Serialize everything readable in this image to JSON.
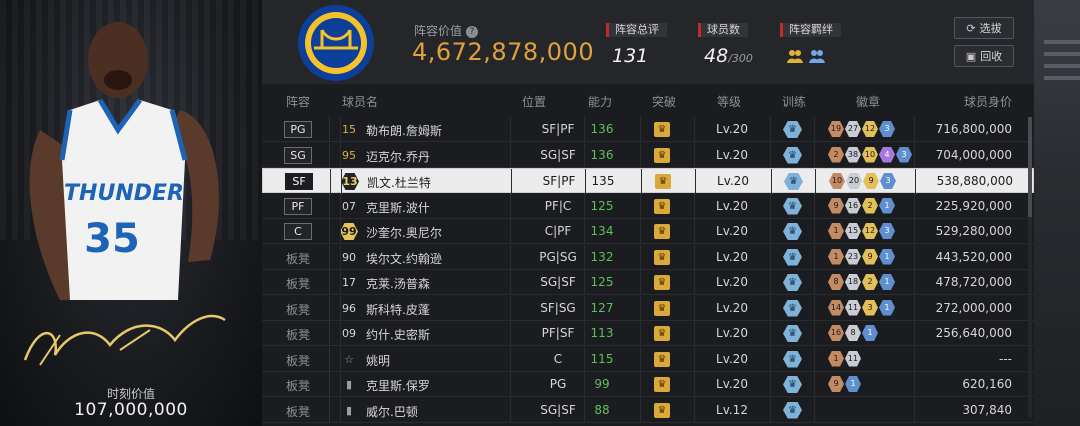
{
  "card": {
    "value_label": "时刻价值",
    "value": "107,000,000",
    "jersey_team": "THUNDER",
    "jersey_number": "35"
  },
  "header": {
    "lineup_label": "阵容价值",
    "lineup_value": "4,672,878,000",
    "rating_label": "阵容总评",
    "rating_value": "131",
    "players_label": "球员数",
    "players_value": "48",
    "players_max": "/300",
    "bond_label": "阵容羁绊",
    "select_button": "选拔",
    "recycle_button": "回收"
  },
  "columns": [
    "阵容",
    "球员名",
    "位置",
    "能力",
    "突破",
    "等级",
    "训练",
    "徽章",
    "球员身价"
  ],
  "rows": [
    {
      "slot": "PG",
      "num": "15",
      "num_style": "gold",
      "name": "勒布朗.詹姆斯",
      "pos": "SF|PF",
      "ability": "136",
      "level": "Lv.20",
      "badges": [
        [
          "bronze",
          "19"
        ],
        [
          "silver",
          "27"
        ],
        [
          "gold",
          "12"
        ],
        [
          "blue",
          "3"
        ]
      ],
      "value": "716,800,000"
    },
    {
      "slot": "SG",
      "num": "95",
      "num_style": "gold",
      "name": "迈克尔.乔丹",
      "pos": "SG|SF",
      "ability": "136",
      "level": "Lv.20",
      "badges": [
        [
          "bronze",
          "2"
        ],
        [
          "silver",
          "38"
        ],
        [
          "gold",
          "10"
        ],
        [
          "purple",
          "4"
        ],
        [
          "blue",
          "3"
        ]
      ],
      "value": "704,000,000"
    },
    {
      "slot": "SF",
      "num": "13",
      "num_style": "hexdark",
      "name": "凯文.杜兰特",
      "pos": "SF|PF",
      "ability": "135",
      "level": "Lv.20",
      "badges": [
        [
          "bronze",
          "10"
        ],
        [
          "silver",
          "20"
        ],
        [
          "gold",
          "9"
        ],
        [
          "blue",
          "3"
        ]
      ],
      "value": "538,880,000"
    },
    {
      "slot": "PF",
      "num": "07",
      "num_style": "plain",
      "name": "克里斯.波什",
      "pos": "PF|C",
      "ability": "125",
      "level": "Lv.20",
      "badges": [
        [
          "bronze",
          "9"
        ],
        [
          "silver",
          "16"
        ],
        [
          "gold",
          "2"
        ],
        [
          "blue",
          "1"
        ]
      ],
      "value": "225,920,000"
    },
    {
      "slot": "C",
      "num": "99",
      "num_style": "hex",
      "name": "沙奎尔.奥尼尔",
      "pos": "C|PF",
      "ability": "134",
      "level": "Lv.20",
      "badges": [
        [
          "bronze",
          "1"
        ],
        [
          "silver",
          "15"
        ],
        [
          "gold",
          "12"
        ],
        [
          "blue",
          "3"
        ]
      ],
      "value": "529,280,000"
    },
    {
      "slot": "板凳",
      "num": "90",
      "num_style": "plain",
      "name": "埃尔文.约翰逊",
      "pos": "PG|SG",
      "ability": "132",
      "level": "Lv.20",
      "badges": [
        [
          "bronze",
          "1"
        ],
        [
          "silver",
          "23"
        ],
        [
          "gold",
          "9"
        ],
        [
          "blue",
          "1"
        ]
      ],
      "value": "443,520,000"
    },
    {
      "slot": "板凳",
      "num": "17",
      "num_style": "plain",
      "name": "克莱.汤普森",
      "pos": "SG|SF",
      "ability": "125",
      "level": "Lv.20",
      "badges": [
        [
          "bronze",
          "8"
        ],
        [
          "silver",
          "18"
        ],
        [
          "gold",
          "2"
        ],
        [
          "blue",
          "1"
        ]
      ],
      "value": "478,720,000"
    },
    {
      "slot": "板凳",
      "num": "96",
      "num_style": "plain",
      "name": "斯科特.皮蓬",
      "pos": "SF|SG",
      "ability": "127",
      "level": "Lv.20",
      "badges": [
        [
          "bronze",
          "14"
        ],
        [
          "silver",
          "11"
        ],
        [
          "gold",
          "3"
        ],
        [
          "blue",
          "1"
        ]
      ],
      "value": "272,000,000"
    },
    {
      "slot": "板凳",
      "num": "09",
      "num_style": "plain",
      "name": "约什.史密斯",
      "pos": "PF|SF",
      "ability": "113",
      "level": "Lv.20",
      "badges": [
        [
          "bronze",
          "16"
        ],
        [
          "silver",
          "8"
        ],
        [
          "blue",
          "1"
        ]
      ],
      "value": "256,640,000"
    },
    {
      "slot": "板凳",
      "num": "☆",
      "num_style": "grey",
      "name": "姚明",
      "pos": "C",
      "ability": "115",
      "level": "Lv.20",
      "badges": [
        [
          "bronze",
          "1"
        ],
        [
          "silver",
          "11"
        ]
      ],
      "value": "---"
    },
    {
      "slot": "板凳",
      "num": "▮",
      "num_style": "grey",
      "name": "克里斯.保罗",
      "pos": "PG",
      "ability": "99",
      "level": "Lv.20",
      "badges": [
        [
          "bronze",
          "9"
        ],
        [
          "blue",
          "1"
        ]
      ],
      "value": "620,160"
    },
    {
      "slot": "板凳",
      "num": "▮",
      "num_style": "grey",
      "name": "威尔.巴顿",
      "pos": "SG|SF",
      "ability": "88",
      "level": "Lv.12",
      "badges": [],
      "value": "307,840"
    }
  ]
}
